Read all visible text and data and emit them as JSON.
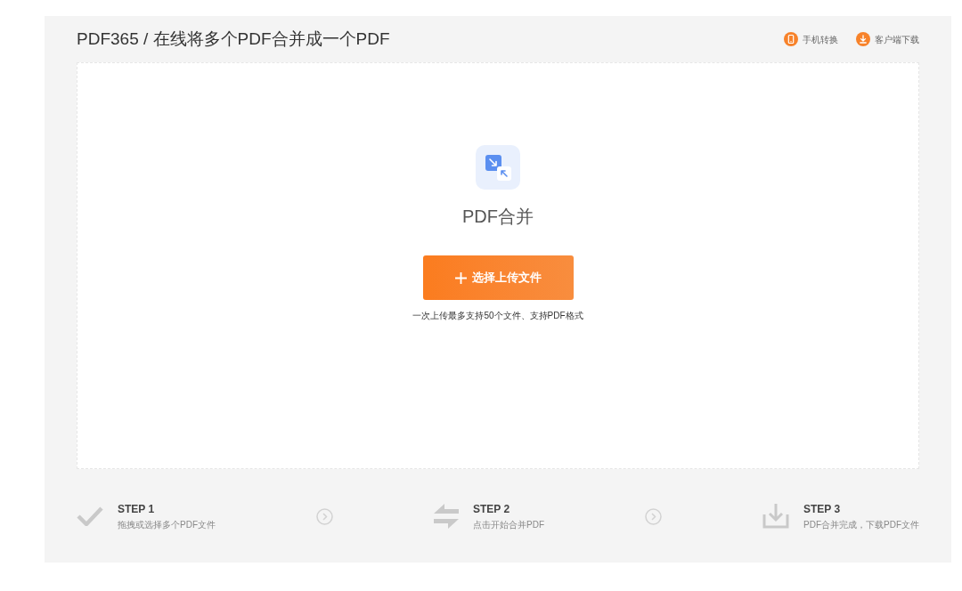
{
  "header": {
    "title": "PDF365 / 在线将多个PDF合并成一个PDF",
    "links": [
      {
        "label": "手机转换"
      },
      {
        "label": "客户端下载"
      }
    ]
  },
  "upload": {
    "title": "PDF合并",
    "button": "选择上传文件",
    "note": "一次上传最多支持50个文件、支持PDF格式"
  },
  "steps": [
    {
      "title": "STEP 1",
      "description": "拖拽或选择多个PDF文件"
    },
    {
      "title": "STEP 2",
      "description": "点击开始合并PDF"
    },
    {
      "title": "STEP 3",
      "description": "PDF合并完成，下载PDF文件"
    }
  ]
}
